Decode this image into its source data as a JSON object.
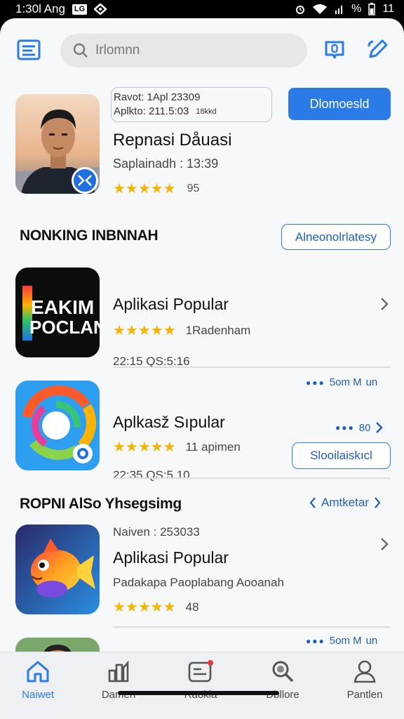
{
  "status_bar": {
    "time": "1:30l Ang",
    "sim_label": "LG",
    "battery_text": "%",
    "battery_level": "11"
  },
  "search": {
    "placeholder": "Irlomnn"
  },
  "featured": {
    "meta_line1": "Ravot: 1Apl 23309",
    "meta_line2_a": "Aplkto: 211.5:03",
    "meta_line2_b": "18kkd",
    "cta_label": "Dlomoesld",
    "title": "Repnasi Dåuasi",
    "subtitle": "Saplainadh : 13:39",
    "rating_count": "95",
    "rating_stars": 4.5
  },
  "section1": {
    "title": "NONKING INBNNAH",
    "button_label": "Alneonolrlatesy"
  },
  "items": [
    {
      "title": "Aplikasi Popular",
      "rating_text": "1Radenham",
      "meta": "22:15  QS:5:16",
      "icon_text_1": "EAKIM",
      "icon_text_2": "POCLAN",
      "rating_stars": 4.5
    },
    {
      "title": "Aplkasž Sıpular",
      "rating_text": "11 apimen",
      "meta": "22:35  QS:5.10",
      "top_dots_text": "5om M",
      "top_dots_suffix": "un",
      "mid_dots_text": "80",
      "button_label": "Slooilaiskıcl",
      "rating_stars": 4.5
    }
  ],
  "section2": {
    "title": "ROPNI AlSo Yhsegsimg",
    "link_label": "Amtketar"
  },
  "item3": {
    "top_line": "Naiven : 253033",
    "title": "Aplikasi Popular",
    "desc": "Padakapa Paoplabang Aooanah",
    "rating_count": "48",
    "rating_stars": 4.5
  },
  "peek": {
    "dots_text": "5om M",
    "dots_suffix": "un"
  },
  "bottom_nav": [
    {
      "label": "Naiwet"
    },
    {
      "label": "Damen"
    },
    {
      "label": "Raokia"
    },
    {
      "label": "Dbllore"
    },
    {
      "label": "Pantlen"
    }
  ],
  "colors": {
    "accent": "#2a7be6",
    "star": "#f4b400",
    "background": "#f7f8fa"
  }
}
